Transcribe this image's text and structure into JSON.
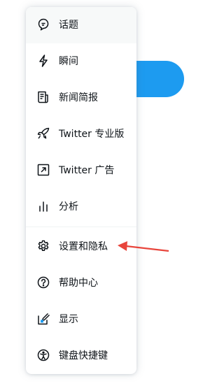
{
  "colors": {
    "accent": "#1d9bf0",
    "arrow": "#e8453c",
    "text": "#0f1419"
  },
  "menu": {
    "items": [
      {
        "label": "话题",
        "icon": "topics-icon",
        "hover": true
      },
      {
        "label": "瞬间",
        "icon": "moments-icon"
      },
      {
        "label": "新闻简报",
        "icon": "newsletter-icon"
      },
      {
        "label": "Twitter 专业版",
        "icon": "rocket-icon"
      },
      {
        "label": "Twitter 广告",
        "icon": "ads-arrow-icon"
      },
      {
        "label": "分析",
        "icon": "analytics-icon"
      },
      {
        "label": "设置和隐私",
        "icon": "gear-icon"
      },
      {
        "label": "帮助中心",
        "icon": "help-icon"
      },
      {
        "label": "显示",
        "icon": "display-icon"
      },
      {
        "label": "键盘快捷键",
        "icon": "accessibility-icon"
      }
    ]
  }
}
